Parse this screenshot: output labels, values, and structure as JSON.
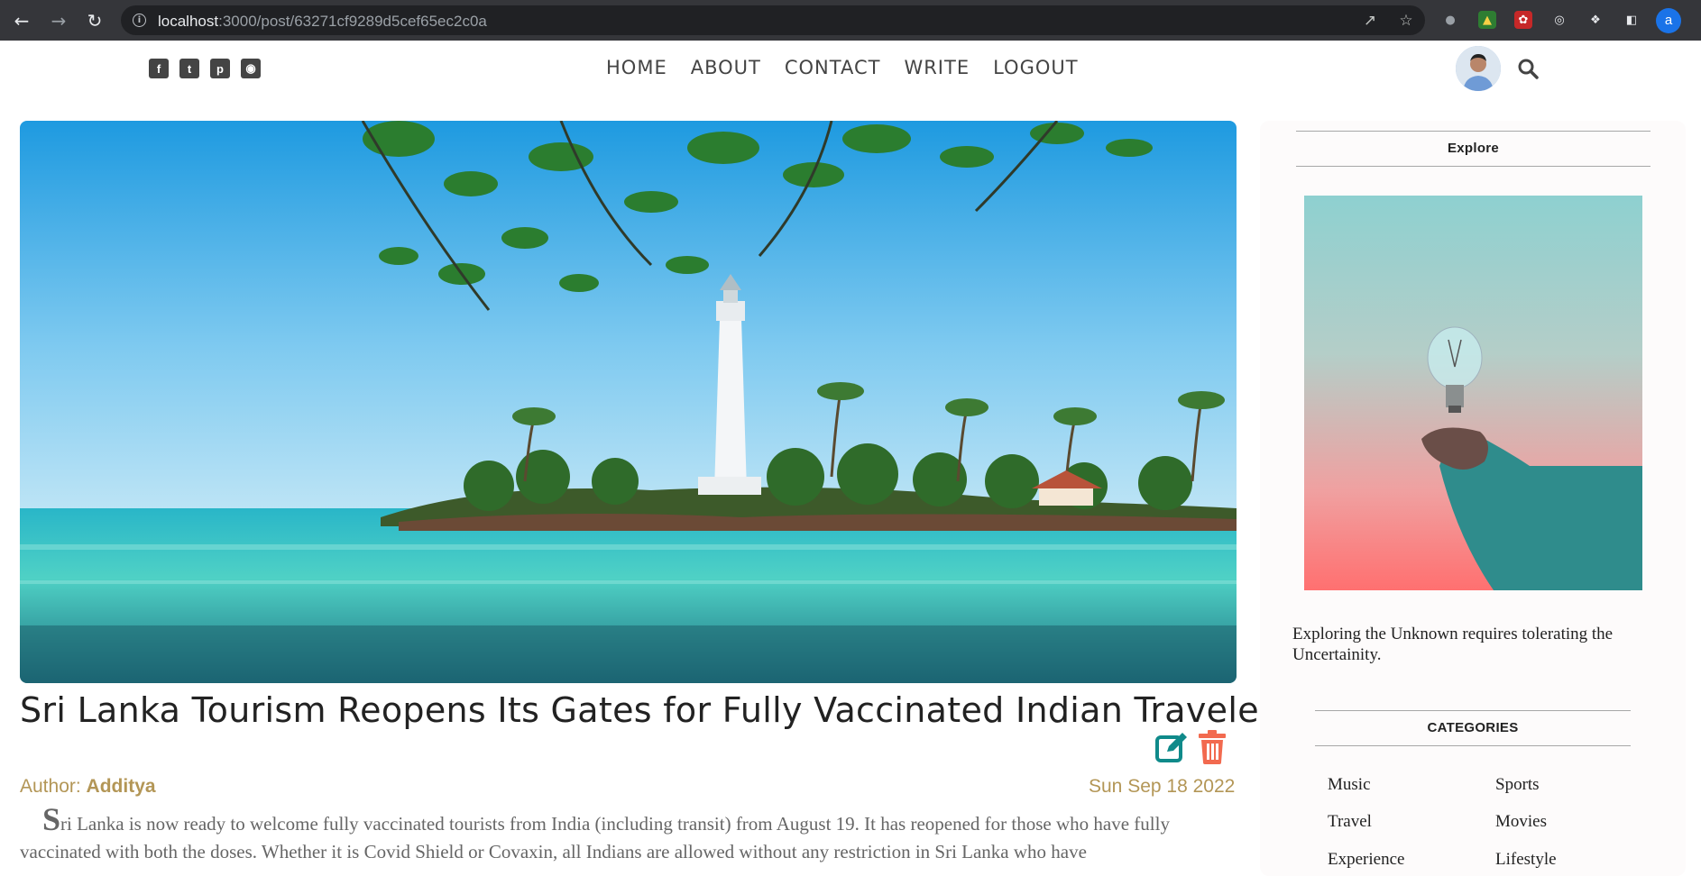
{
  "browser": {
    "url_host": "localhost",
    "url_path": ":3000/post/63271cf9289d5cef65ec2c0a",
    "profile_initial": "a"
  },
  "header": {
    "social": [
      "facebook-icon",
      "twitter-icon",
      "pinterest-icon",
      "instagram-icon"
    ],
    "menu": [
      "HOME",
      "ABOUT",
      "CONTACT",
      "WRITE",
      "LOGOUT"
    ]
  },
  "post": {
    "title": "Sri Lanka Tourism Reopens Its Gates for Fully Vaccinated Indian Traveler",
    "author_label": "Author: ",
    "author": "Additya",
    "date": "Sun Sep 18 2022",
    "body_first_letter": "S",
    "body_rest": "ri Lanka is now ready to welcome fully vaccinated tourists from India (including transit) from August 19. It has reopened for those who have fully vaccinated with both the doses. Whether it is Covid Shield or Covaxin, all Indians are allowed without any restriction in Sri Lanka who have"
  },
  "sidebar": {
    "explore_title": "Explore",
    "explore_text": "Exploring the Unknown requires tolerating the Uncertainity.",
    "categories_title": "CATEGORIES",
    "categories": [
      "Music",
      "Sports",
      "Travel",
      "Movies",
      "Experience",
      "Lifestyle"
    ]
  },
  "colors": {
    "accent_meta": "#b39656",
    "edit_icon": "#0f8a8a",
    "delete_icon": "#f26a4f"
  }
}
